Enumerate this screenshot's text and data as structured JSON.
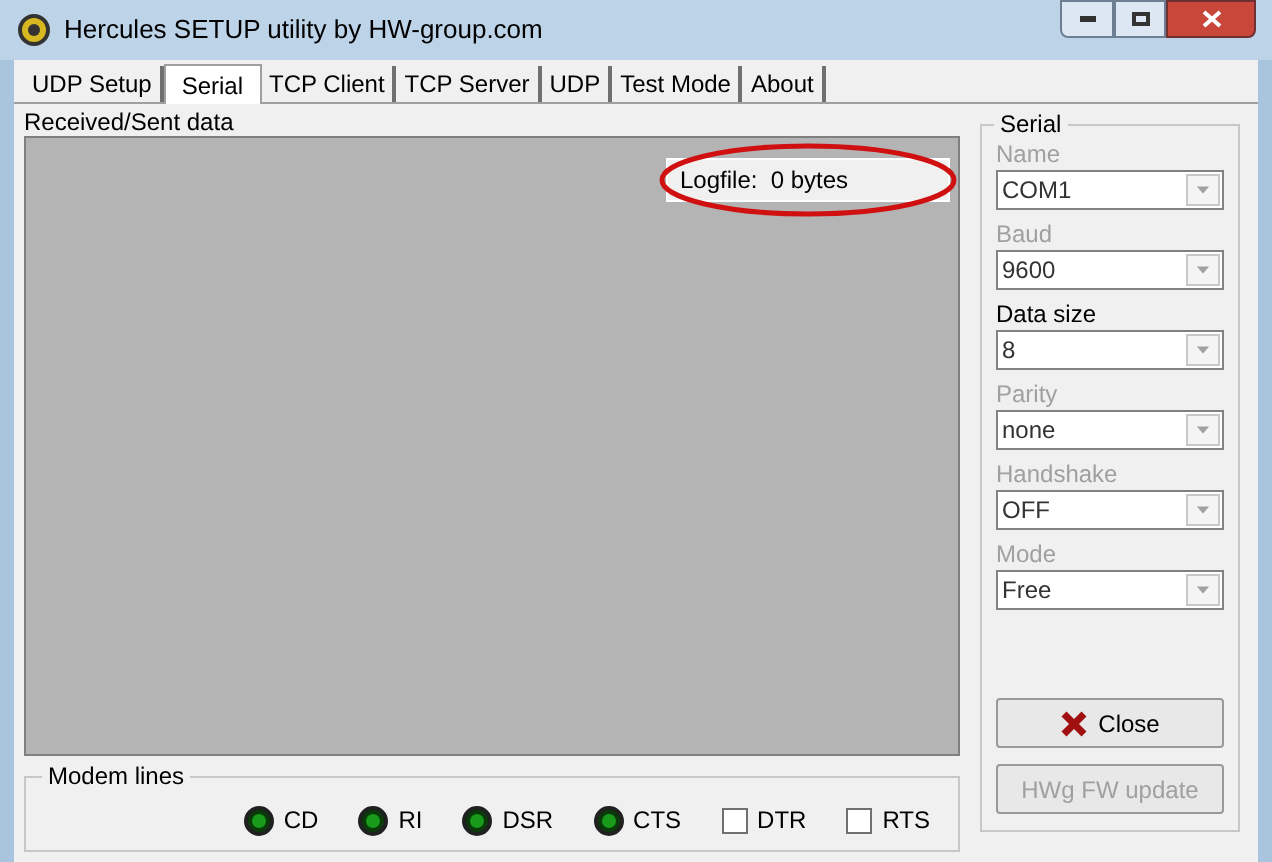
{
  "window": {
    "title": "Hercules SETUP utility by HW-group.com"
  },
  "tabs": [
    {
      "label": "UDP Setup",
      "selected": false
    },
    {
      "label": "Serial",
      "selected": true
    },
    {
      "label": "TCP Client",
      "selected": false
    },
    {
      "label": "TCP Server",
      "selected": false
    },
    {
      "label": "UDP",
      "selected": false
    },
    {
      "label": "Test Mode",
      "selected": false
    },
    {
      "label": "About",
      "selected": false
    }
  ],
  "data_panel": {
    "label": "Received/Sent data",
    "logfile": "Logfile:  0 bytes"
  },
  "modem_lines": {
    "label": "Modem lines",
    "items": [
      {
        "kind": "led",
        "label": "CD"
      },
      {
        "kind": "led",
        "label": "RI"
      },
      {
        "kind": "led",
        "label": "DSR"
      },
      {
        "kind": "led",
        "label": "CTS"
      },
      {
        "kind": "checkbox",
        "label": "DTR",
        "checked": false
      },
      {
        "kind": "checkbox",
        "label": "RTS",
        "checked": false
      }
    ]
  },
  "serial": {
    "label": "Serial",
    "fields": [
      {
        "label": "Name",
        "value": "COM1",
        "disabled": true
      },
      {
        "label": "Baud",
        "value": "9600",
        "disabled": true
      },
      {
        "label": "Data size",
        "value": "8",
        "disabled": false
      },
      {
        "label": "Parity",
        "value": "none",
        "disabled": true
      },
      {
        "label": "Handshake",
        "value": "OFF",
        "disabled": true
      },
      {
        "label": "Mode",
        "value": "Free",
        "disabled": true
      }
    ],
    "buttons": [
      {
        "label": "Close",
        "disabled": false
      },
      {
        "label": "HWg FW update",
        "disabled": true
      }
    ]
  }
}
